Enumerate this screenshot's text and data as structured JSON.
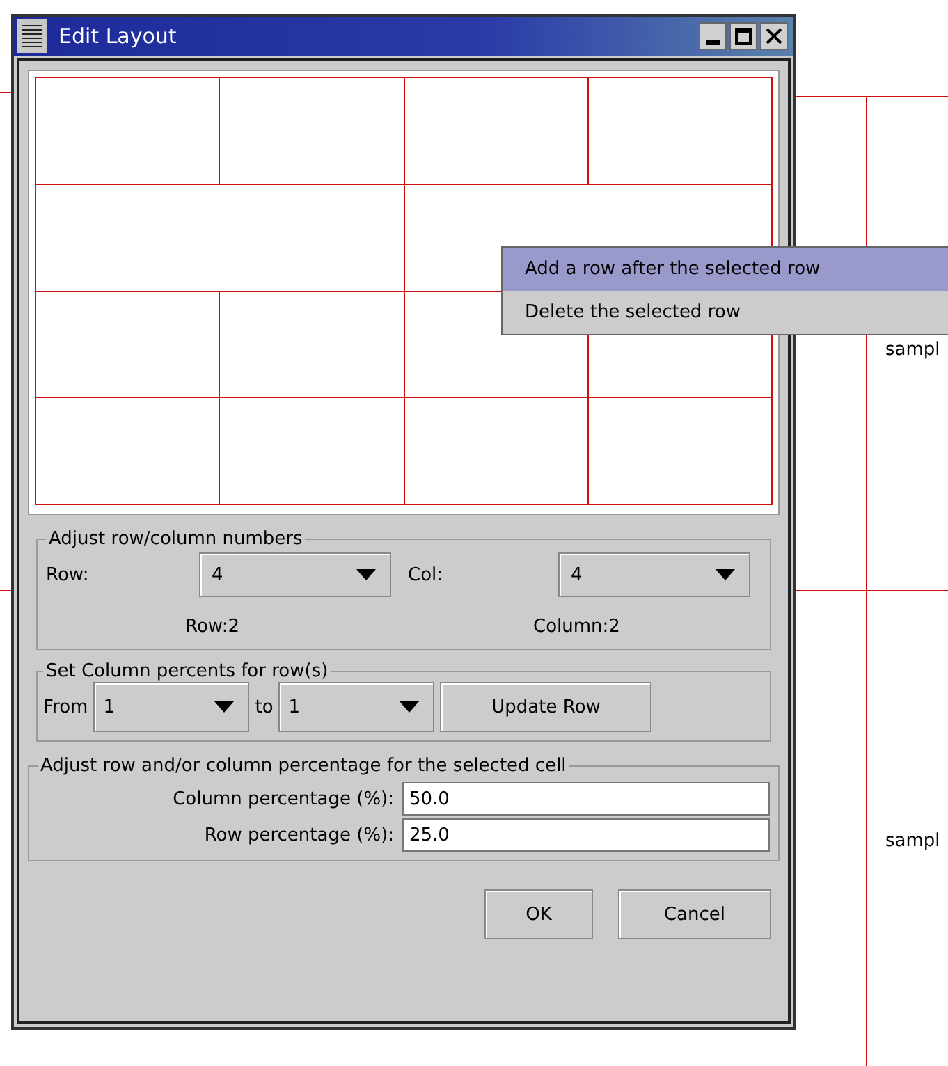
{
  "window": {
    "title": "Edit Layout"
  },
  "background_labels": [
    "sampl",
    "sampl"
  ],
  "context_menu": {
    "items": [
      {
        "label": "Add a row after the selected row",
        "selected": true
      },
      {
        "label": "Delete the selected row",
        "selected": false
      }
    ]
  },
  "row_column_numbers": {
    "legend": "Adjust row/column numbers",
    "row_label": "Row:",
    "row_value": "4",
    "col_label": "Col:",
    "col_value": "4",
    "row_info": "Row:2",
    "column_info": "Column:2"
  },
  "column_percents": {
    "legend": "Set Column percents for row(s)",
    "from_label": "From",
    "from_value": "1",
    "to_label": "to",
    "to_value": "1",
    "button": "Update Row"
  },
  "cell_percentage": {
    "legend": "Adjust row and/or column percentage for the selected cell",
    "fields": [
      {
        "label": "Column percentage (%):",
        "value": "50.0"
      },
      {
        "label": "Row percentage (%):",
        "value": "25.0"
      }
    ]
  },
  "buttons": [
    "OK",
    "Cancel"
  ]
}
